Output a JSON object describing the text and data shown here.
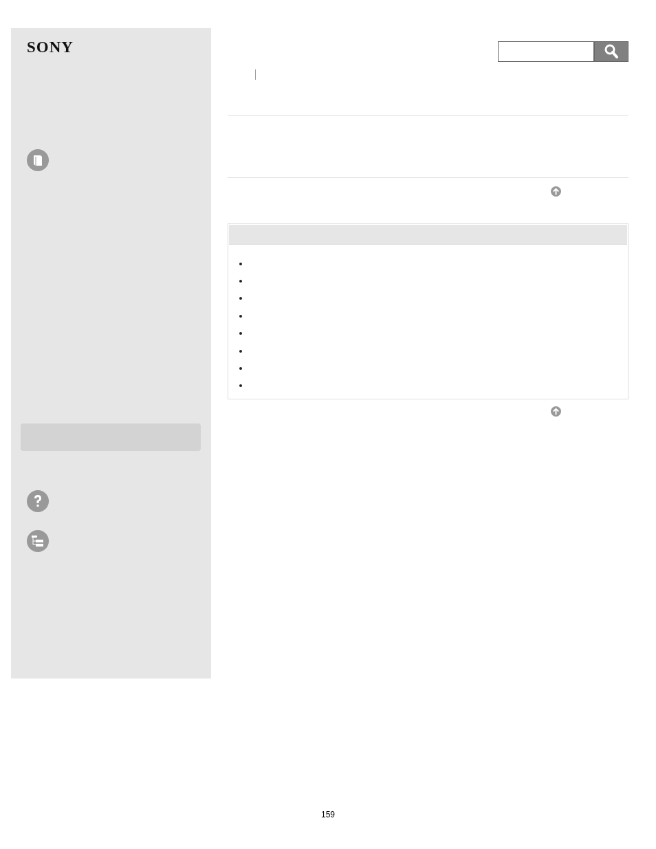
{
  "sidebar": {
    "logo": "SONY",
    "items": [
      {
        "kind": "book"
      },
      {
        "kind": "highlight"
      },
      {
        "kind": "help"
      },
      {
        "kind": "tree"
      }
    ]
  },
  "notes_box": {
    "items": [
      {
        "kind": "bullet"
      },
      {
        "kind": "bullet"
      },
      {
        "kind": "bullet"
      },
      {
        "kind": "bullet"
      },
      {
        "kind": "bullet"
      },
      {
        "kind": "bullet"
      },
      {
        "kind": "bullet"
      },
      {
        "kind": "bullet"
      }
    ]
  },
  "page_number": "159"
}
